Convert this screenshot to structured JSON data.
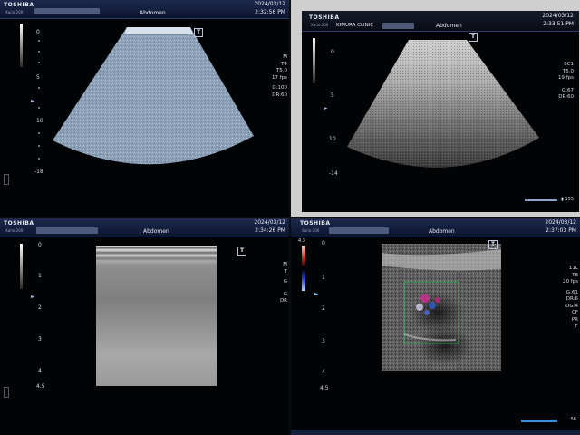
{
  "screen1": {
    "brand": "TOSHIBA",
    "model": "Xario 200",
    "preset": "Abdomen",
    "date": "2024/03/12",
    "time": "2:32:56 PM",
    "params": [
      "M",
      "T4",
      "T5.0",
      "17 fps",
      "G:100",
      "DR:60"
    ],
    "depth_marks": [
      "0",
      "5",
      "10",
      "-18"
    ],
    "t_marker": "T"
  },
  "screen2": {
    "brand": "TOSHIBA",
    "model": "Xario 200",
    "clinic": "KIMURA CLINIC",
    "preset": "Abdomen",
    "date": "2024/03/12",
    "time": "2:33:51 PM",
    "params": [
      "6C1",
      "T5.0",
      "19 fps",
      "G:67",
      "DR:60"
    ],
    "depth_marks": [
      "0",
      "5",
      "10",
      "-14"
    ],
    "frame_counter": "155",
    "t_marker": "T"
  },
  "screen3": {
    "brand": "TOSHIBA",
    "model": "Xario 200",
    "preset": "Abdomen",
    "date": "2024/03/12",
    "time": "2:34:26 PM",
    "params": [
      "M",
      "T",
      "G",
      "G",
      "DR"
    ],
    "depth_marks": [
      "0",
      "1",
      "2",
      "3",
      "4",
      "4.5"
    ],
    "t_marker": "T"
  },
  "screen4": {
    "brand": "TOSHIBA",
    "model": "Xario 200",
    "preset": "Abdomen",
    "date": "2024/03/12",
    "time": "2:37:03 PM",
    "params": [
      "11L",
      "T8",
      "20 fps",
      "G:61",
      "DR:6",
      "DG:4",
      "CF",
      "PR",
      "F"
    ],
    "depth_marks": [
      "0",
      "1",
      "2",
      "3",
      "4",
      "4.5"
    ],
    "scale_top": "4.3",
    "frame_counter": "56",
    "t_marker": "T"
  }
}
